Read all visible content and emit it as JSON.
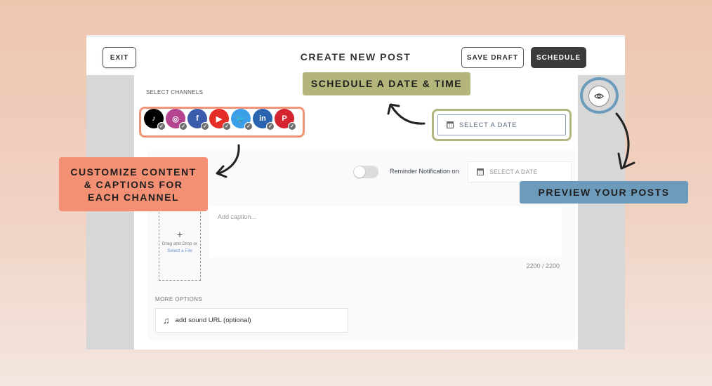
{
  "header": {
    "title": "CREATE NEW POST",
    "exit_label": "EXIT",
    "save_draft_label": "SAVE DRAFT",
    "schedule_label": "SCHEDULE"
  },
  "channels": {
    "label": "SELECT CHANNELS",
    "items": [
      {
        "name": "TikTok",
        "glyph": "♪",
        "color": "#000000",
        "selected": true
      },
      {
        "name": "Instagram",
        "glyph": "◎",
        "color": "#b4448f",
        "selected": true
      },
      {
        "name": "Facebook",
        "glyph": "f",
        "color": "#3b5bab",
        "selected": true
      },
      {
        "name": "YouTube",
        "glyph": "▶",
        "color": "#e52d27",
        "selected": true
      },
      {
        "name": "Twitter",
        "glyph": "🐦",
        "color": "#3b9ee8",
        "selected": true
      },
      {
        "name": "LinkedIn",
        "glyph": "in",
        "color": "#2a63b0",
        "selected": true
      },
      {
        "name": "Pinterest",
        "glyph": "P",
        "color": "#d4242f",
        "selected": true
      }
    ],
    "check_glyph": "✓"
  },
  "schedule": {
    "date_placeholder": "SELECT A DATE"
  },
  "reminder": {
    "toggle_on": false,
    "label": "Reminder Notification on",
    "date_placeholder": "SELECT A DATE"
  },
  "upload": {
    "plus": "+",
    "text": "Drag and Drop or",
    "link": "Select a File"
  },
  "caption": {
    "placeholder": "Add caption...",
    "counter": "2200 / 2200"
  },
  "more_options": {
    "label": "MORE OPTIONS",
    "sound_placeholder": "add sound URL (optional)"
  },
  "annotations": {
    "schedule": "SCHEDULE A DATE & TIME",
    "customize_lines": [
      "CUSTOMIZE CONTENT",
      "& CAPTIONS FOR",
      "EACH CHANNEL"
    ],
    "preview": "PREVIEW YOUR POSTS"
  },
  "colors": {
    "annotation_green": "#b3b57a",
    "annotation_salmon": "#f38f72",
    "annotation_blue": "#6d9bbb",
    "primary_button": "#3b3b3b"
  }
}
